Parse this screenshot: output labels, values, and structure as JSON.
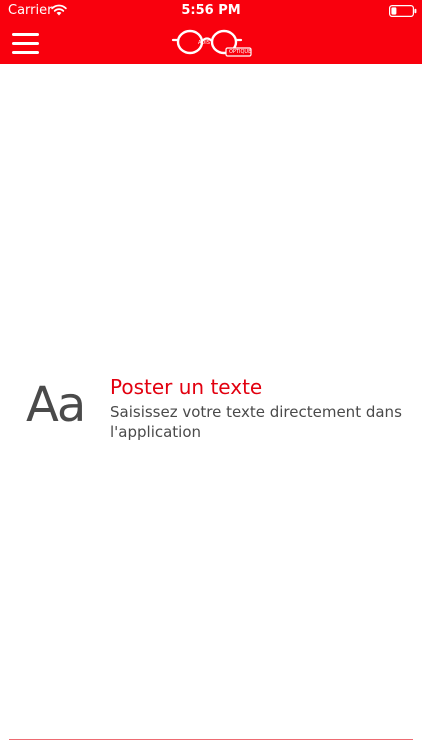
{
  "status_bar": {
    "carrier": "Carrier",
    "time": "5:56 PM",
    "wifi_icon": "wifi-icon",
    "battery_icon": "battery-low-icon"
  },
  "nav": {
    "menu_icon": "hamburger-menu-icon",
    "logo": {
      "icon": "glasses-logo",
      "text_left": "ADIS",
      "text_right": "OPTIQUE"
    }
  },
  "option": {
    "icon_text": "Aa",
    "title": "Poster un texte",
    "description": "Saisissez votre texte directement dans l'application"
  },
  "colors": {
    "brand_red": "#f9000d",
    "title_red": "#e2000f",
    "text_gray": "#4a4a4a",
    "divider": "#ee6b72"
  }
}
